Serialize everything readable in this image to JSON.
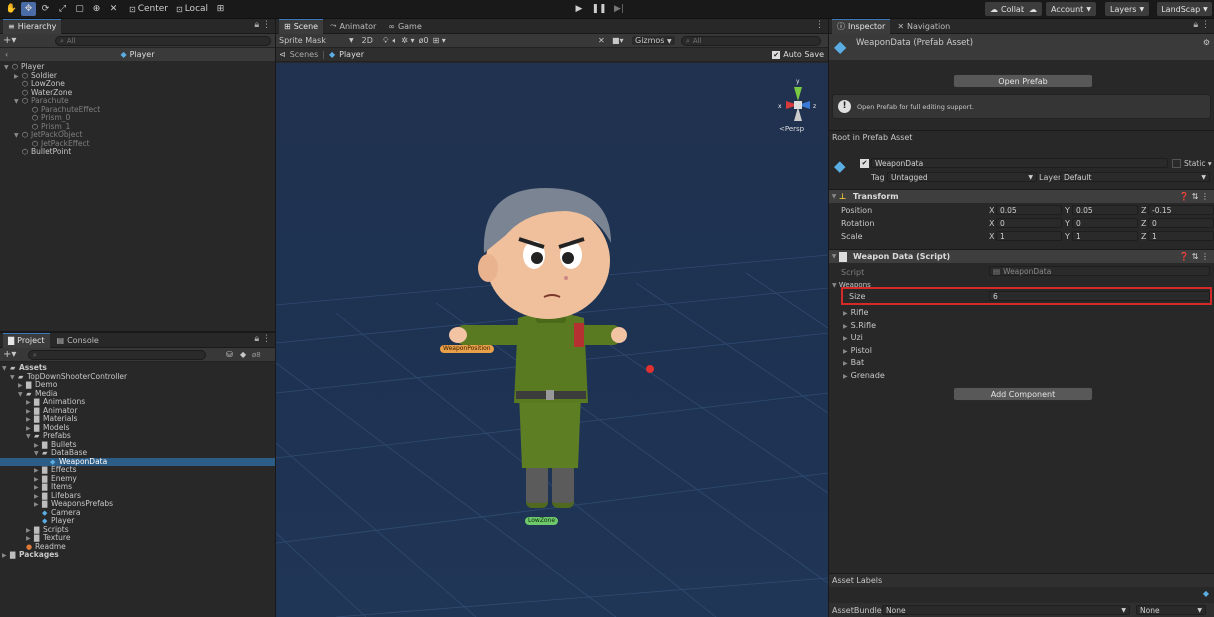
{
  "toolbar": {
    "pivot_label": "Center",
    "space_label": "Local",
    "collab_label": "Collab",
    "account_label": "Account",
    "layers_label": "Layers",
    "layout_label": "LandScap"
  },
  "hierarchy": {
    "tab_label": "Hierarchy",
    "search_placeholder": "All",
    "prefab_header": "Player",
    "items": [
      {
        "label": "Player",
        "depth": 0,
        "arrow": "▼",
        "dim": false
      },
      {
        "label": "Soldier",
        "depth": 1,
        "arrow": "▶",
        "dim": false
      },
      {
        "label": "LowZone",
        "depth": 1,
        "arrow": "",
        "dim": false
      },
      {
        "label": "WaterZone",
        "depth": 1,
        "arrow": "",
        "dim": false
      },
      {
        "label": "Parachute",
        "depth": 1,
        "arrow": "▼",
        "dim": true
      },
      {
        "label": "ParachuteEffect",
        "depth": 2,
        "arrow": "",
        "dim": true
      },
      {
        "label": "Prism_0",
        "depth": 2,
        "arrow": "",
        "dim": true
      },
      {
        "label": "Prism_1",
        "depth": 2,
        "arrow": "",
        "dim": true
      },
      {
        "label": "JetPackObject",
        "depth": 1,
        "arrow": "▼",
        "dim": true
      },
      {
        "label": "JetPackEffect",
        "depth": 2,
        "arrow": "",
        "dim": true
      },
      {
        "label": "BulletPoint",
        "depth": 1,
        "arrow": "",
        "dim": false
      }
    ]
  },
  "project": {
    "tab_project": "Project",
    "tab_console": "Console",
    "hidden_count": "8",
    "items": [
      {
        "label": "Assets",
        "depth": 0,
        "arrow": "▼",
        "type": "folder-open",
        "bold": true
      },
      {
        "label": "TopDownShooterController",
        "depth": 1,
        "arrow": "▼",
        "type": "folder-open"
      },
      {
        "label": "Demo",
        "depth": 2,
        "arrow": "▶",
        "type": "folder"
      },
      {
        "label": "Media",
        "depth": 2,
        "arrow": "▼",
        "type": "folder-open"
      },
      {
        "label": "Animations",
        "depth": 3,
        "arrow": "▶",
        "type": "folder"
      },
      {
        "label": "Animator",
        "depth": 3,
        "arrow": "▶",
        "type": "folder"
      },
      {
        "label": "Materials",
        "depth": 3,
        "arrow": "▶",
        "type": "folder"
      },
      {
        "label": "Models",
        "depth": 3,
        "arrow": "▶",
        "type": "folder"
      },
      {
        "label": "Prefabs",
        "depth": 3,
        "arrow": "▼",
        "type": "folder-open"
      },
      {
        "label": "Bullets",
        "depth": 4,
        "arrow": "▶",
        "type": "folder"
      },
      {
        "label": "DataBase",
        "depth": 4,
        "arrow": "▼",
        "type": "folder-open"
      },
      {
        "label": "WeaponData",
        "depth": 5,
        "arrow": "",
        "type": "prefab",
        "selected": true
      },
      {
        "label": "Effects",
        "depth": 4,
        "arrow": "▶",
        "type": "folder"
      },
      {
        "label": "Enemy",
        "depth": 4,
        "arrow": "▶",
        "type": "folder"
      },
      {
        "label": "Items",
        "depth": 4,
        "arrow": "▶",
        "type": "folder"
      },
      {
        "label": "Lifebars",
        "depth": 4,
        "arrow": "▶",
        "type": "folder"
      },
      {
        "label": "WeaponsPrefabs",
        "depth": 4,
        "arrow": "▶",
        "type": "folder"
      },
      {
        "label": "Camera",
        "depth": 4,
        "arrow": "",
        "type": "prefab"
      },
      {
        "label": "Player",
        "depth": 4,
        "arrow": "",
        "type": "prefab"
      },
      {
        "label": "Scripts",
        "depth": 3,
        "arrow": "▶",
        "type": "folder"
      },
      {
        "label": "Texture",
        "depth": 3,
        "arrow": "▶",
        "type": "folder"
      },
      {
        "label": "Readme",
        "depth": 2,
        "arrow": "",
        "type": "readme"
      },
      {
        "label": "Packages",
        "depth": 0,
        "arrow": "▶",
        "type": "folder",
        "bold": true
      }
    ]
  },
  "scene": {
    "tab_scene": "Scene",
    "tab_animator": "Animator",
    "tab_game": "Game",
    "draw_mode": "Sprite Mask",
    "mode_2d": "2D",
    "hidden_count": "0",
    "gizmos_label": "Gizmos",
    "search_placeholder": "All",
    "breadcrumb_scenes": "Scenes",
    "breadcrumb_player": "Player",
    "auto_save_label": "Auto Save",
    "persp_label": "Persp",
    "weapon_position_label": "WeaponPosition",
    "lowzone_label": "LowZone"
  },
  "inspector": {
    "tab_inspector": "Inspector",
    "tab_navigation": "Navigation",
    "asset_title": "WeaponData (Prefab Asset)",
    "open_prefab_label": "Open Prefab",
    "help_text": "Open Prefab for full editing support.",
    "root_label": "Root in Prefab Asset",
    "object_name": "WeaponData",
    "static_label": "Static",
    "tag_label": "Tag",
    "tag_value": "Untagged",
    "layer_label": "Layer",
    "layer_value": "Default",
    "transform": {
      "title": "Transform",
      "rows": [
        {
          "label": "Position",
          "x": "0.05",
          "y": "0.05",
          "z": "-0.15"
        },
        {
          "label": "Rotation",
          "x": "0",
          "y": "0",
          "z": "0"
        },
        {
          "label": "Scale",
          "x": "1",
          "y": "1",
          "z": "1"
        }
      ]
    },
    "script_component": {
      "title": "Weapon Data (Script)",
      "script_label": "Script",
      "script_value": "WeaponData",
      "weapons_label": "Weapons",
      "size_label": "Size",
      "size_value": "6",
      "elements": [
        "Rifle",
        "S.Rifle",
        "Uzi",
        "Pistol",
        "Bat",
        "Grenade"
      ]
    },
    "add_component_label": "Add Component",
    "asset_labels_title": "Asset Labels",
    "assetbundle_label": "AssetBundle",
    "assetbundle_value": "None",
    "assetbundle_variant": "None"
  },
  "colors": {
    "accent_blue": "#3a79bb",
    "highlight_red": "#d42a2a",
    "selection": "#2c5d87"
  }
}
